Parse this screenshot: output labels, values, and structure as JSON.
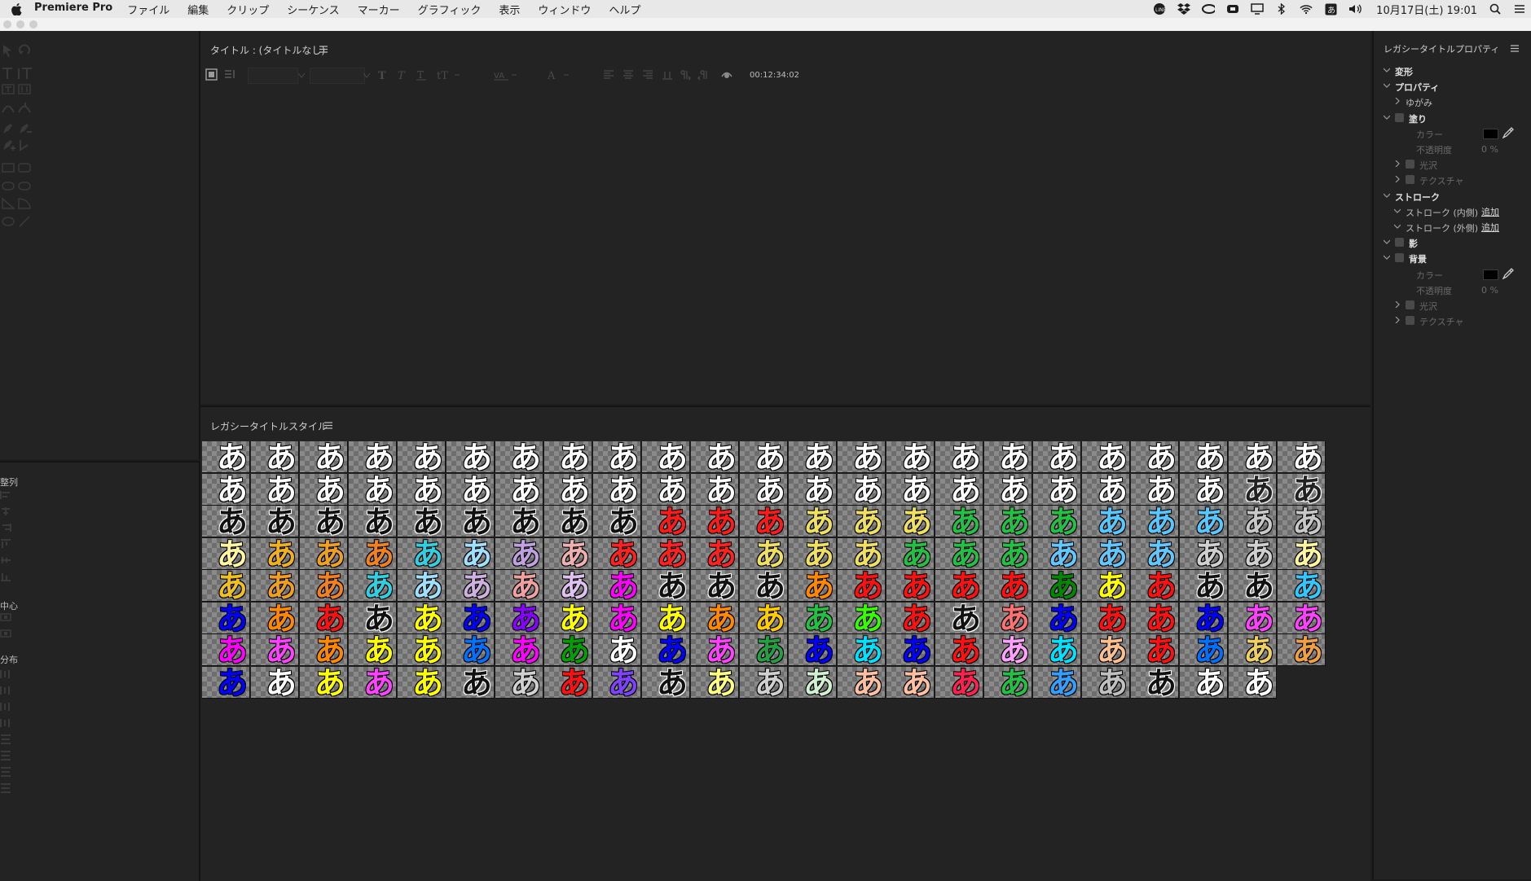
{
  "menubar": {
    "app_name": "Premiere Pro",
    "items": [
      "ファイル",
      "編集",
      "クリップ",
      "シーケンス",
      "マーカー",
      "グラフィック",
      "表示",
      "ウィンドウ",
      "ヘルプ"
    ],
    "clock": "10月17日(土) 19:01"
  },
  "title_panel": {
    "title": "タイトル : (タイトルなし)",
    "timecode": "00:12:34:02"
  },
  "left_panel": {
    "labels": [
      "整列",
      "中心",
      "分布"
    ]
  },
  "styles_panel": {
    "title": "レガシータイトルスタイル",
    "glyph": "あ",
    "rows": [
      [
        "#fff",
        "#fff",
        "#fff",
        "#fff",
        "#fff",
        "#fff",
        "#fff",
        "#fff",
        "#fff",
        "#fff",
        "#fff",
        "#fff",
        "#fff",
        "#fff",
        "#fff",
        "#fff",
        "#fff",
        "#fff",
        "#fff",
        "#fff",
        "#fff",
        "#fff",
        "#fff"
      ],
      [
        "#fff",
        "#fff",
        "#fff",
        "#fff",
        "#fff",
        "#fff",
        "#fff",
        "#fff",
        "#fff",
        "#fff",
        "#fff",
        "#fff",
        "#fff",
        "#fff",
        "#fff",
        "#fff",
        "#fff",
        "#fff",
        "#fff",
        "#fff",
        "#fff",
        "#222",
        "#222"
      ],
      [
        "#111",
        "#111",
        "#111",
        "#111",
        "#111",
        "#111",
        "#111",
        "#111",
        "#111",
        "#ff1a1a",
        "#ff1a1a",
        "#ff1a1a",
        "#f0e060",
        "#f0e060",
        "#f0e060",
        "#22c043",
        "#22c043",
        "#22c043",
        "#55c8ff",
        "#55c8ff",
        "#55c8ff",
        "#c8c8c8",
        "#c8c8c8"
      ],
      [
        "#fff6a0",
        "#f0b020",
        "#f0a020",
        "#f08020",
        "#30d0e0",
        "#a0e0ff",
        "#c0a0e0",
        "#f0b0b0",
        "#ff2020",
        "#ff2020",
        "#ff2020",
        "#f0e060",
        "#f0e060",
        "#f0e060",
        "#22c043",
        "#22c043",
        "#22c043",
        "#60c8ff",
        "#60c8ff",
        "#60c8ff",
        "#d0d0d0",
        "#d0d0d0",
        "#fff6a0"
      ],
      [
        "#f0c020",
        "#f0a020",
        "#f08020",
        "#30d0e0",
        "#a0e0ff",
        "#d0b0e0",
        "#f0a0a0",
        "#e0c0f0",
        "#ff00ff",
        "#111",
        "#111",
        "#111",
        "#ff8800",
        "#ff1010",
        "#ff1010",
        "#ff1010",
        "#ff1010",
        "#008800",
        "#ffff00",
        "#ff1010",
        "#111",
        "#111",
        "#30c8ff"
      ],
      [
        "#0000ff",
        "#ff8800",
        "#ff1010",
        "#111",
        "#ffff00",
        "#0000ff",
        "#8800ff",
        "#ffff00",
        "#ff00ff",
        "#ffff00",
        "#ff8800",
        "#ffcc00",
        "#22c043",
        "#33ff00",
        "#ff1010",
        "#111",
        "#ff7070",
        "#0000ff",
        "#ff1010",
        "#ff1010",
        "#0000ff",
        "#ff40ff",
        "#ff40ff"
      ],
      [
        "#ff00ff",
        "#ff40ff",
        "#ff8800",
        "#ffff00",
        "#ffff00",
        "#0070ff",
        "#ff00ff",
        "#00a000",
        "#fff",
        "#0000ff",
        "#ff40ff",
        "#22a043",
        "#0000ff",
        "#00e0ff",
        "#0000ff",
        "#ff1010",
        "#ffa0ff",
        "#00e0ff",
        "#ffc090",
        "#ff1010",
        "#0070ff",
        "#f0d060",
        "#f0a040"
      ],
      [
        "#0000ff",
        "#fff",
        "#ffff00",
        "#ff40ff",
        "#ffff00",
        "#111",
        "#d0d0d0",
        "#ff1010",
        "#8040ff",
        "#111",
        "#ffff80",
        "#d0d0d0",
        "#d0f0d0",
        "#ffc0a0",
        "#ffc0a0",
        "#ff2050",
        "#22c043",
        "#30a0ff",
        "#c0c0c0",
        "#111",
        "#fff",
        "#fff"
      ]
    ]
  },
  "properties_panel": {
    "title": "レガシータイトルプロパティ",
    "items": [
      {
        "label": "変形",
        "level": 0,
        "checkbox": false,
        "dim": false
      },
      {
        "label": "プロパティ",
        "level": 0,
        "checkbox": false,
        "dim": false
      },
      {
        "label": "ゆがみ",
        "level": 1,
        "checkbox": false,
        "dim": false
      },
      {
        "label": "塗り",
        "level": 0,
        "checkbox": true,
        "dim": false
      },
      {
        "label": "カラー",
        "level": 2,
        "checkbox": false,
        "dim": true
      },
      {
        "label": "不透明度",
        "level": 2,
        "checkbox": false,
        "dim": true
      },
      {
        "label": "光沢",
        "level": 1,
        "checkbox": true,
        "dim": true
      },
      {
        "label": "テクスチャ",
        "level": 1,
        "checkbox": true,
        "dim": true
      },
      {
        "label": "ストローク",
        "level": 0,
        "checkbox": false,
        "dim": false
      },
      {
        "label": "ストローク (内側)",
        "level": 1,
        "checkbox": false,
        "dim": false
      },
      {
        "label": "ストローク (外側)",
        "level": 1,
        "checkbox": false,
        "dim": false
      },
      {
        "label": "影",
        "level": 0,
        "checkbox": true,
        "dim": false
      },
      {
        "label": "背景",
        "level": 0,
        "checkbox": true,
        "dim": false
      },
      {
        "label": "カラー",
        "level": 2,
        "checkbox": false,
        "dim": true
      },
      {
        "label": "不透明度",
        "level": 2,
        "checkbox": false,
        "dim": true
      },
      {
        "label": "光沢",
        "level": 1,
        "checkbox": true,
        "dim": true
      },
      {
        "label": "テクスチャ",
        "level": 1,
        "checkbox": true,
        "dim": true
      }
    ],
    "fill_opacity": "0 %",
    "bg_opacity": "0 %",
    "add_label": "追加"
  }
}
